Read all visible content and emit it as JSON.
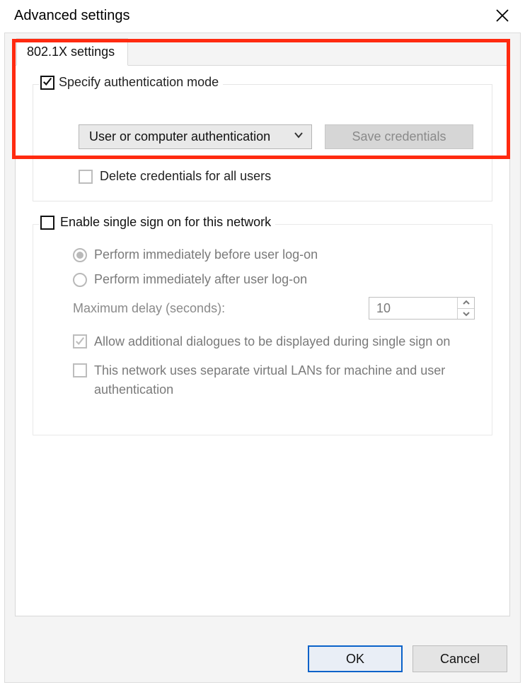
{
  "window": {
    "title": "Advanced settings"
  },
  "tab": {
    "label": "802.1X settings"
  },
  "auth_group": {
    "specify_label": "Specify authentication mode",
    "specify_checked": true,
    "mode_selected": "User or computer authentication",
    "save_credentials_label": "Save credentials",
    "delete_credentials_label": "Delete credentials for all users",
    "delete_credentials_checked": false
  },
  "sso_group": {
    "enable_label": "Enable single sign on for this network",
    "enable_checked": false,
    "radio_before_label": "Perform immediately before user log-on",
    "radio_before_selected": true,
    "radio_after_label": "Perform immediately after user log-on",
    "radio_after_selected": false,
    "delay_label": "Maximum delay (seconds):",
    "delay_value": "10",
    "allow_dialogues_label": "Allow additional dialogues to be displayed during single sign on",
    "allow_dialogues_checked": true,
    "separate_vlan_label": "This network uses separate virtual LANs for machine and user authentication",
    "separate_vlan_checked": false
  },
  "footer": {
    "ok_label": "OK",
    "cancel_label": "Cancel"
  }
}
